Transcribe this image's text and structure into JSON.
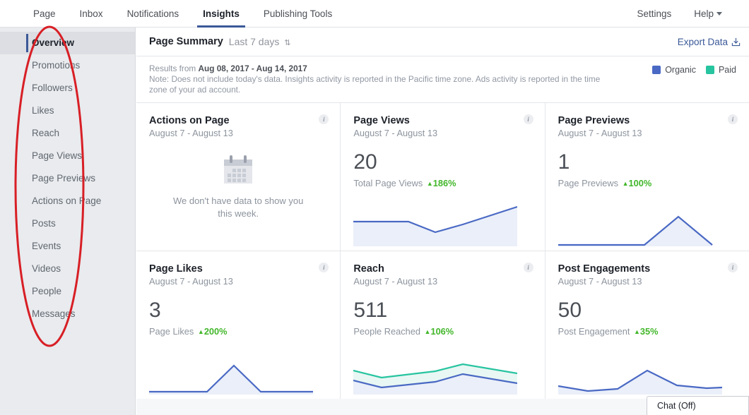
{
  "topnav": {
    "left_items": [
      {
        "label": "Page",
        "active": false
      },
      {
        "label": "Inbox",
        "active": false
      },
      {
        "label": "Notifications",
        "active": false
      },
      {
        "label": "Insights",
        "active": true
      },
      {
        "label": "Publishing Tools",
        "active": false
      }
    ],
    "settings_label": "Settings",
    "help_label": "Help"
  },
  "sidebar": {
    "items": [
      {
        "label": "Overview",
        "active": true
      },
      {
        "label": "Promotions",
        "active": false
      },
      {
        "label": "Followers",
        "active": false
      },
      {
        "label": "Likes",
        "active": false
      },
      {
        "label": "Reach",
        "active": false
      },
      {
        "label": "Page Views",
        "active": false
      },
      {
        "label": "Page Previews",
        "active": false
      },
      {
        "label": "Actions on Page",
        "active": false
      },
      {
        "label": "Posts",
        "active": false
      },
      {
        "label": "Events",
        "active": false
      },
      {
        "label": "Videos",
        "active": false
      },
      {
        "label": "People",
        "active": false
      },
      {
        "label": "Messages",
        "active": false
      }
    ]
  },
  "summary": {
    "title": "Page Summary",
    "range_label": "Last 7 days",
    "range_arrows": "≡",
    "export_label": "Export Data"
  },
  "results": {
    "prefix": "Results from ",
    "date_range": "Aug 08, 2017 - Aug 14, 2017",
    "note": "Note: Does not include today's data. Insights activity is reported in the Pacific time zone. Ads activity is reported in the time zone of your ad account."
  },
  "legend": [
    {
      "label": "Organic",
      "color": "#4a69c4"
    },
    {
      "label": "Paid",
      "color": "#27c4a0"
    }
  ],
  "colors": {
    "organic": "#4a69c4",
    "paid": "#27c4a0",
    "positive": "#42b72a",
    "accent": "#3b5998",
    "area_fill": "#eaeff9",
    "paid_fill": "#e8f7f3"
  },
  "cards": [
    {
      "title": "Actions on Page",
      "subtitle": "August 7 - August 13",
      "empty": true,
      "empty_text": "We don't have data to show you this week.",
      "icon": "calendar-icon",
      "info": "i"
    },
    {
      "title": "Page Views",
      "subtitle": "August 7 - August 13",
      "value": "20",
      "metric_label": "Total Page Views",
      "delta": "186%",
      "delta_direction": "up",
      "info": "i"
    },
    {
      "title": "Page Previews",
      "subtitle": "August 7 - August 13",
      "value": "1",
      "metric_label": "Page Previews",
      "delta": "100%",
      "delta_direction": "up",
      "info": "i"
    },
    {
      "title": "Page Likes",
      "subtitle": "August 7 - August 13",
      "value": "3",
      "metric_label": "Page Likes",
      "delta": "200%",
      "delta_direction": "up",
      "info": "i"
    },
    {
      "title": "Reach",
      "subtitle": "August 7 - August 13",
      "value": "511",
      "metric_label": "People Reached",
      "delta": "106%",
      "delta_direction": "up",
      "info": "i"
    },
    {
      "title": "Post Engagements",
      "subtitle": "August 7 - August 13",
      "value": "50",
      "metric_label": "Post Engagement",
      "delta": "35%",
      "delta_direction": "up",
      "info": "i"
    }
  ],
  "chart_data": [
    {
      "type": "area",
      "title": "Page Views",
      "series": [
        {
          "name": "Organic",
          "values": [
            12,
            12,
            12,
            12,
            9,
            14,
            22
          ]
        }
      ],
      "x": [
        "Aug 7",
        "Aug 8",
        "Aug 9",
        "Aug 10",
        "Aug 11",
        "Aug 12",
        "Aug 13"
      ],
      "ylim": [
        0,
        24
      ],
      "grid": false,
      "legend": "none"
    },
    {
      "type": "area",
      "title": "Page Previews",
      "series": [
        {
          "name": "Organic",
          "values": [
            0,
            0,
            0,
            0,
            0,
            1,
            0
          ]
        }
      ],
      "x": [
        "Aug 7",
        "Aug 8",
        "Aug 9",
        "Aug 10",
        "Aug 11",
        "Aug 12",
        "Aug 13"
      ],
      "ylim": [
        0,
        1
      ],
      "grid": false,
      "legend": "none"
    },
    {
      "type": "area",
      "title": "Page Likes",
      "series": [
        {
          "name": "Organic",
          "values": [
            0,
            0,
            0,
            0,
            3,
            0,
            0
          ]
        }
      ],
      "x": [
        "Aug 7",
        "Aug 8",
        "Aug 9",
        "Aug 10",
        "Aug 11",
        "Aug 12",
        "Aug 13"
      ],
      "ylim": [
        0,
        3
      ],
      "grid": false,
      "legend": "none"
    },
    {
      "type": "area",
      "title": "Reach",
      "series": [
        {
          "name": "Paid",
          "values": [
            75,
            55,
            66,
            82,
            100,
            78,
            62
          ]
        },
        {
          "name": "Organic",
          "values": [
            48,
            28,
            38,
            55,
            72,
            52,
            40
          ]
        }
      ],
      "x": [
        "Aug 7",
        "Aug 8",
        "Aug 9",
        "Aug 10",
        "Aug 11",
        "Aug 12",
        "Aug 13"
      ],
      "ylim": [
        0,
        110
      ],
      "grid": false,
      "legend": "top-right"
    },
    {
      "type": "area",
      "title": "Post Engagements",
      "series": [
        {
          "name": "Organic",
          "values": [
            10,
            4,
            6,
            18,
            34,
            12,
            9
          ]
        }
      ],
      "x": [
        "Aug 7",
        "Aug 8",
        "Aug 9",
        "Aug 10",
        "Aug 11",
        "Aug 12",
        "Aug 13"
      ],
      "ylim": [
        0,
        38
      ],
      "grid": false,
      "legend": "none"
    }
  ],
  "chat": {
    "label": "Chat (Off)"
  }
}
